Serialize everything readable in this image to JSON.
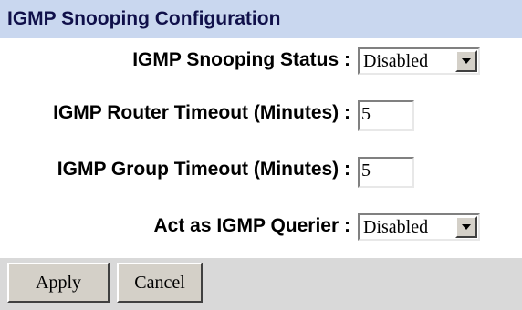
{
  "header": {
    "title": "IGMP Snooping Configuration"
  },
  "fields": {
    "snooping_status": {
      "label": "IGMP Snooping Status :",
      "value": "Disabled"
    },
    "router_timeout": {
      "label": "IGMP Router Timeout (Minutes) :",
      "value": "5"
    },
    "group_timeout": {
      "label": "IGMP Group Timeout (Minutes) :",
      "value": "5"
    },
    "querier": {
      "label": "Act as IGMP Querier :",
      "value": "Disabled"
    }
  },
  "buttons": {
    "apply": "Apply",
    "cancel": "Cancel"
  },
  "icons": {
    "dropdown": "chevron-down-icon"
  },
  "colors": {
    "header_bg": "#c9d7ef",
    "footer_bg": "#d9d9d9",
    "title": "#10104a"
  }
}
